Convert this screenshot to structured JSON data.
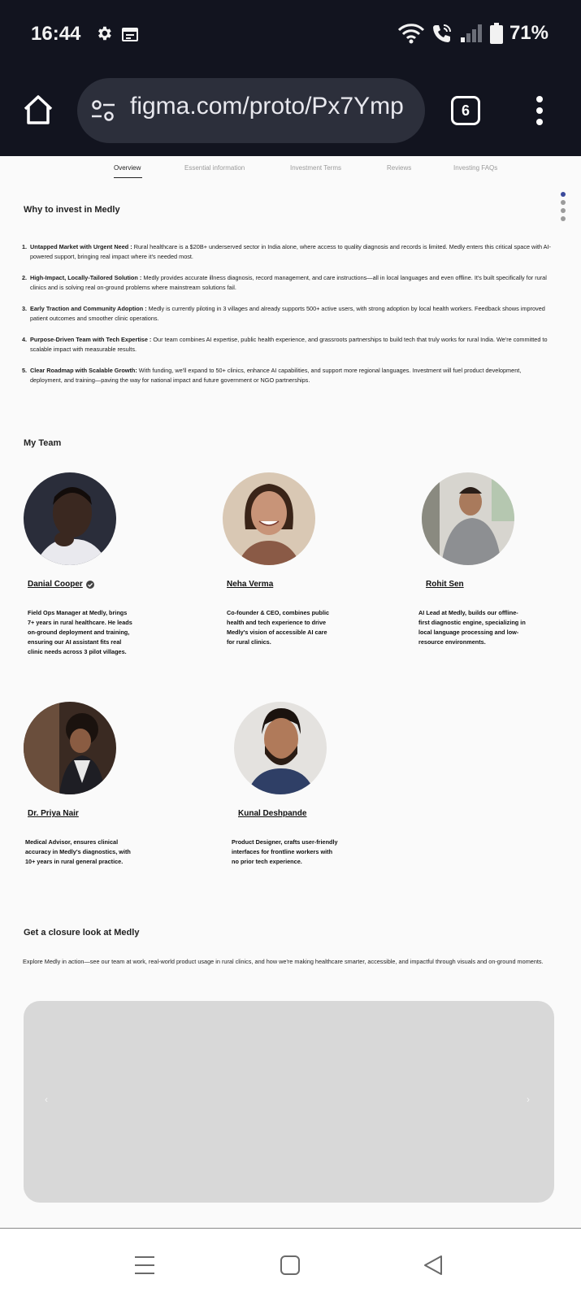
{
  "status_bar": {
    "time": "16:44",
    "battery": "71%",
    "icons": [
      "settings-gear-icon",
      "calendar-icon",
      "wifi-icon",
      "wifi-call-icon",
      "signal-icon",
      "battery-icon"
    ]
  },
  "browser": {
    "url": "figma.com/proto/Px7Ymp",
    "tab_count": "6"
  },
  "nav": {
    "tabs": [
      {
        "label": "Overview",
        "active": true
      },
      {
        "label": "Essential information",
        "active": false
      },
      {
        "label": "Investment Terms",
        "active": false
      },
      {
        "label": "Reviews",
        "active": false
      },
      {
        "label": "Investing FAQs",
        "active": false
      }
    ]
  },
  "why_invest": {
    "heading": "Why to invest in Medly",
    "items": [
      {
        "num": "1.",
        "title": "Untapped Market with Urgent Need :",
        "text": " Rural healthcare is a $20B+ underserved sector in India alone, where access to quality diagnosis and records is limited. Medly enters this critical space with AI-powered support, bringing real impact where it's needed most."
      },
      {
        "num": "2.",
        "title": "High-Impact, Locally-Tailored Solution :",
        "text": " Medly provides accurate illness diagnosis, record management, and care instructions—all in local languages and even offline. It's built specifically for rural clinics and is solving real on-ground problems where mainstream solutions fail."
      },
      {
        "num": "3.",
        "title": "Early Traction and Community Adoption :",
        "text": " Medly is currently piloting in 3 villages and already supports 500+ active users, with strong adoption by local health workers. Feedback shows improved patient outcomes and smoother clinic operations."
      },
      {
        "num": "4.",
        "title": "Purpose-Driven Team with Tech Expertise :",
        "text": " Our team combines AI expertise, public health experience, and grassroots partnerships to build tech that truly works for rural India. We're committed to scalable impact with measurable results."
      },
      {
        "num": "5.",
        "title": "Clear Roadmap with Scalable Growth:",
        "text": " With funding, we'll expand to 50+ clinics, enhance AI capabilities, and support more regional languages. Investment will fuel product development, deployment, and training—paving the way for national impact and future government or NGO partnerships."
      }
    ]
  },
  "team": {
    "heading": "My Team",
    "members": [
      {
        "name": "Danial Cooper",
        "verified": true,
        "bio": "Field Ops Manager at Medly, brings 7+ years in rural healthcare. He leads on-ground deployment and training, ensuring our AI assistant fits real clinic needs across 3 pilot villages."
      },
      {
        "name": "Neha Verma",
        "verified": false,
        "bio": "Co-founder & CEO, combines public health and tech experience to drive Medly's vision of accessible AI care for rural clinics."
      },
      {
        "name": "Rohit Sen",
        "verified": false,
        "bio": "AI Lead at Medly, builds our offline-first diagnostic engine, specializing in local language processing and low-resource environments."
      },
      {
        "name": "Dr. Priya Nair",
        "verified": false,
        "bio": " Medical Advisor, ensures clinical accuracy in Medly's diagnostics, with 10+ years in rural general practice."
      },
      {
        "name": "Kunal Deshpande",
        "verified": false,
        "bio": " Product Designer, crafts user-friendly interfaces for frontline workers with no prior tech experience."
      }
    ]
  },
  "closure": {
    "heading": "Get a closure look at Medly",
    "text": "Explore Medly in action—see our team at work, real-world product usage in rural clinics, and how we're making healthcare smarter, accessible, and impactful through visuals and on-ground moments.",
    "prev_arrow": "‹",
    "next_arrow": "›"
  },
  "colors": {
    "chrome_bg": "#12141f",
    "urlbar_bg": "#2c2f3b",
    "page_bg": "#fafafa",
    "carousel_bg": "#d8d8d8",
    "active_dot": "#3b4a9c"
  }
}
